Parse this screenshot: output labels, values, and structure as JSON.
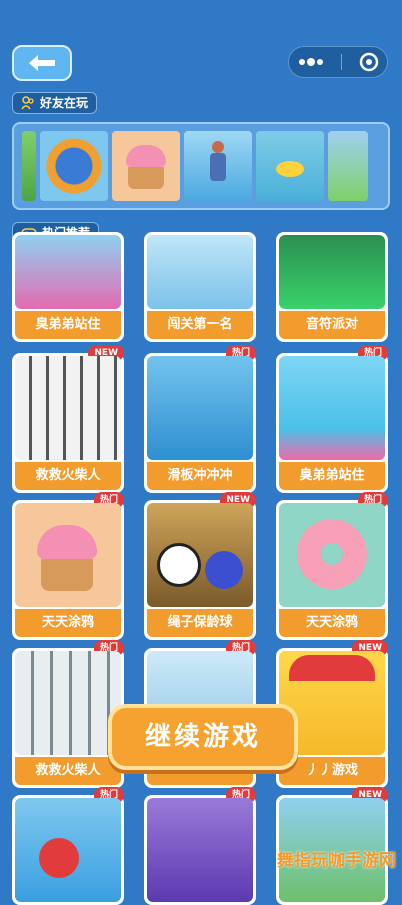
{
  "header": {
    "back_icon": "arrow-left-icon",
    "capsule_icons": [
      "more-dots-icon",
      "close-circle-icon"
    ]
  },
  "friends_section": {
    "label": "好友在玩",
    "icon": "friends-icon",
    "thumbnails": [
      "pole-climb",
      "ring-runner",
      "cupcake-drawing",
      "skater-girl",
      "duck-cliff",
      "pole-climb-2"
    ]
  },
  "recommend_section": {
    "label": "热门推荐",
    "icon": "gamepad-icon"
  },
  "cards": [
    {
      "title": "臭弟弟站住",
      "badge": ""
    },
    {
      "title": "闯关第一名",
      "badge": ""
    },
    {
      "title": "音符派对",
      "badge": ""
    },
    {
      "title": "救救火柴人",
      "badge": "NEW"
    },
    {
      "title": "滑板冲冲冲",
      "badge": "热门"
    },
    {
      "title": "臭弟弟站住",
      "badge": "热门"
    },
    {
      "title": "天天涂鸦",
      "badge": "热门"
    },
    {
      "title": "绳子保龄球",
      "badge": "NEW"
    },
    {
      "title": "天天涂鸦",
      "badge": "热门"
    },
    {
      "title": "救救火柴人",
      "badge": "热门"
    },
    {
      "title": "",
      "badge": "热门"
    },
    {
      "title": "丿丿游戏",
      "badge": "NEW"
    },
    {
      "title": "",
      "badge": "热门"
    },
    {
      "title": "",
      "badge": "热门"
    },
    {
      "title": "",
      "badge": "NEW"
    }
  ],
  "continue_button": {
    "label": "继续游戏"
  },
  "watermark": {
    "text": "舞指玩咖手游网"
  }
}
